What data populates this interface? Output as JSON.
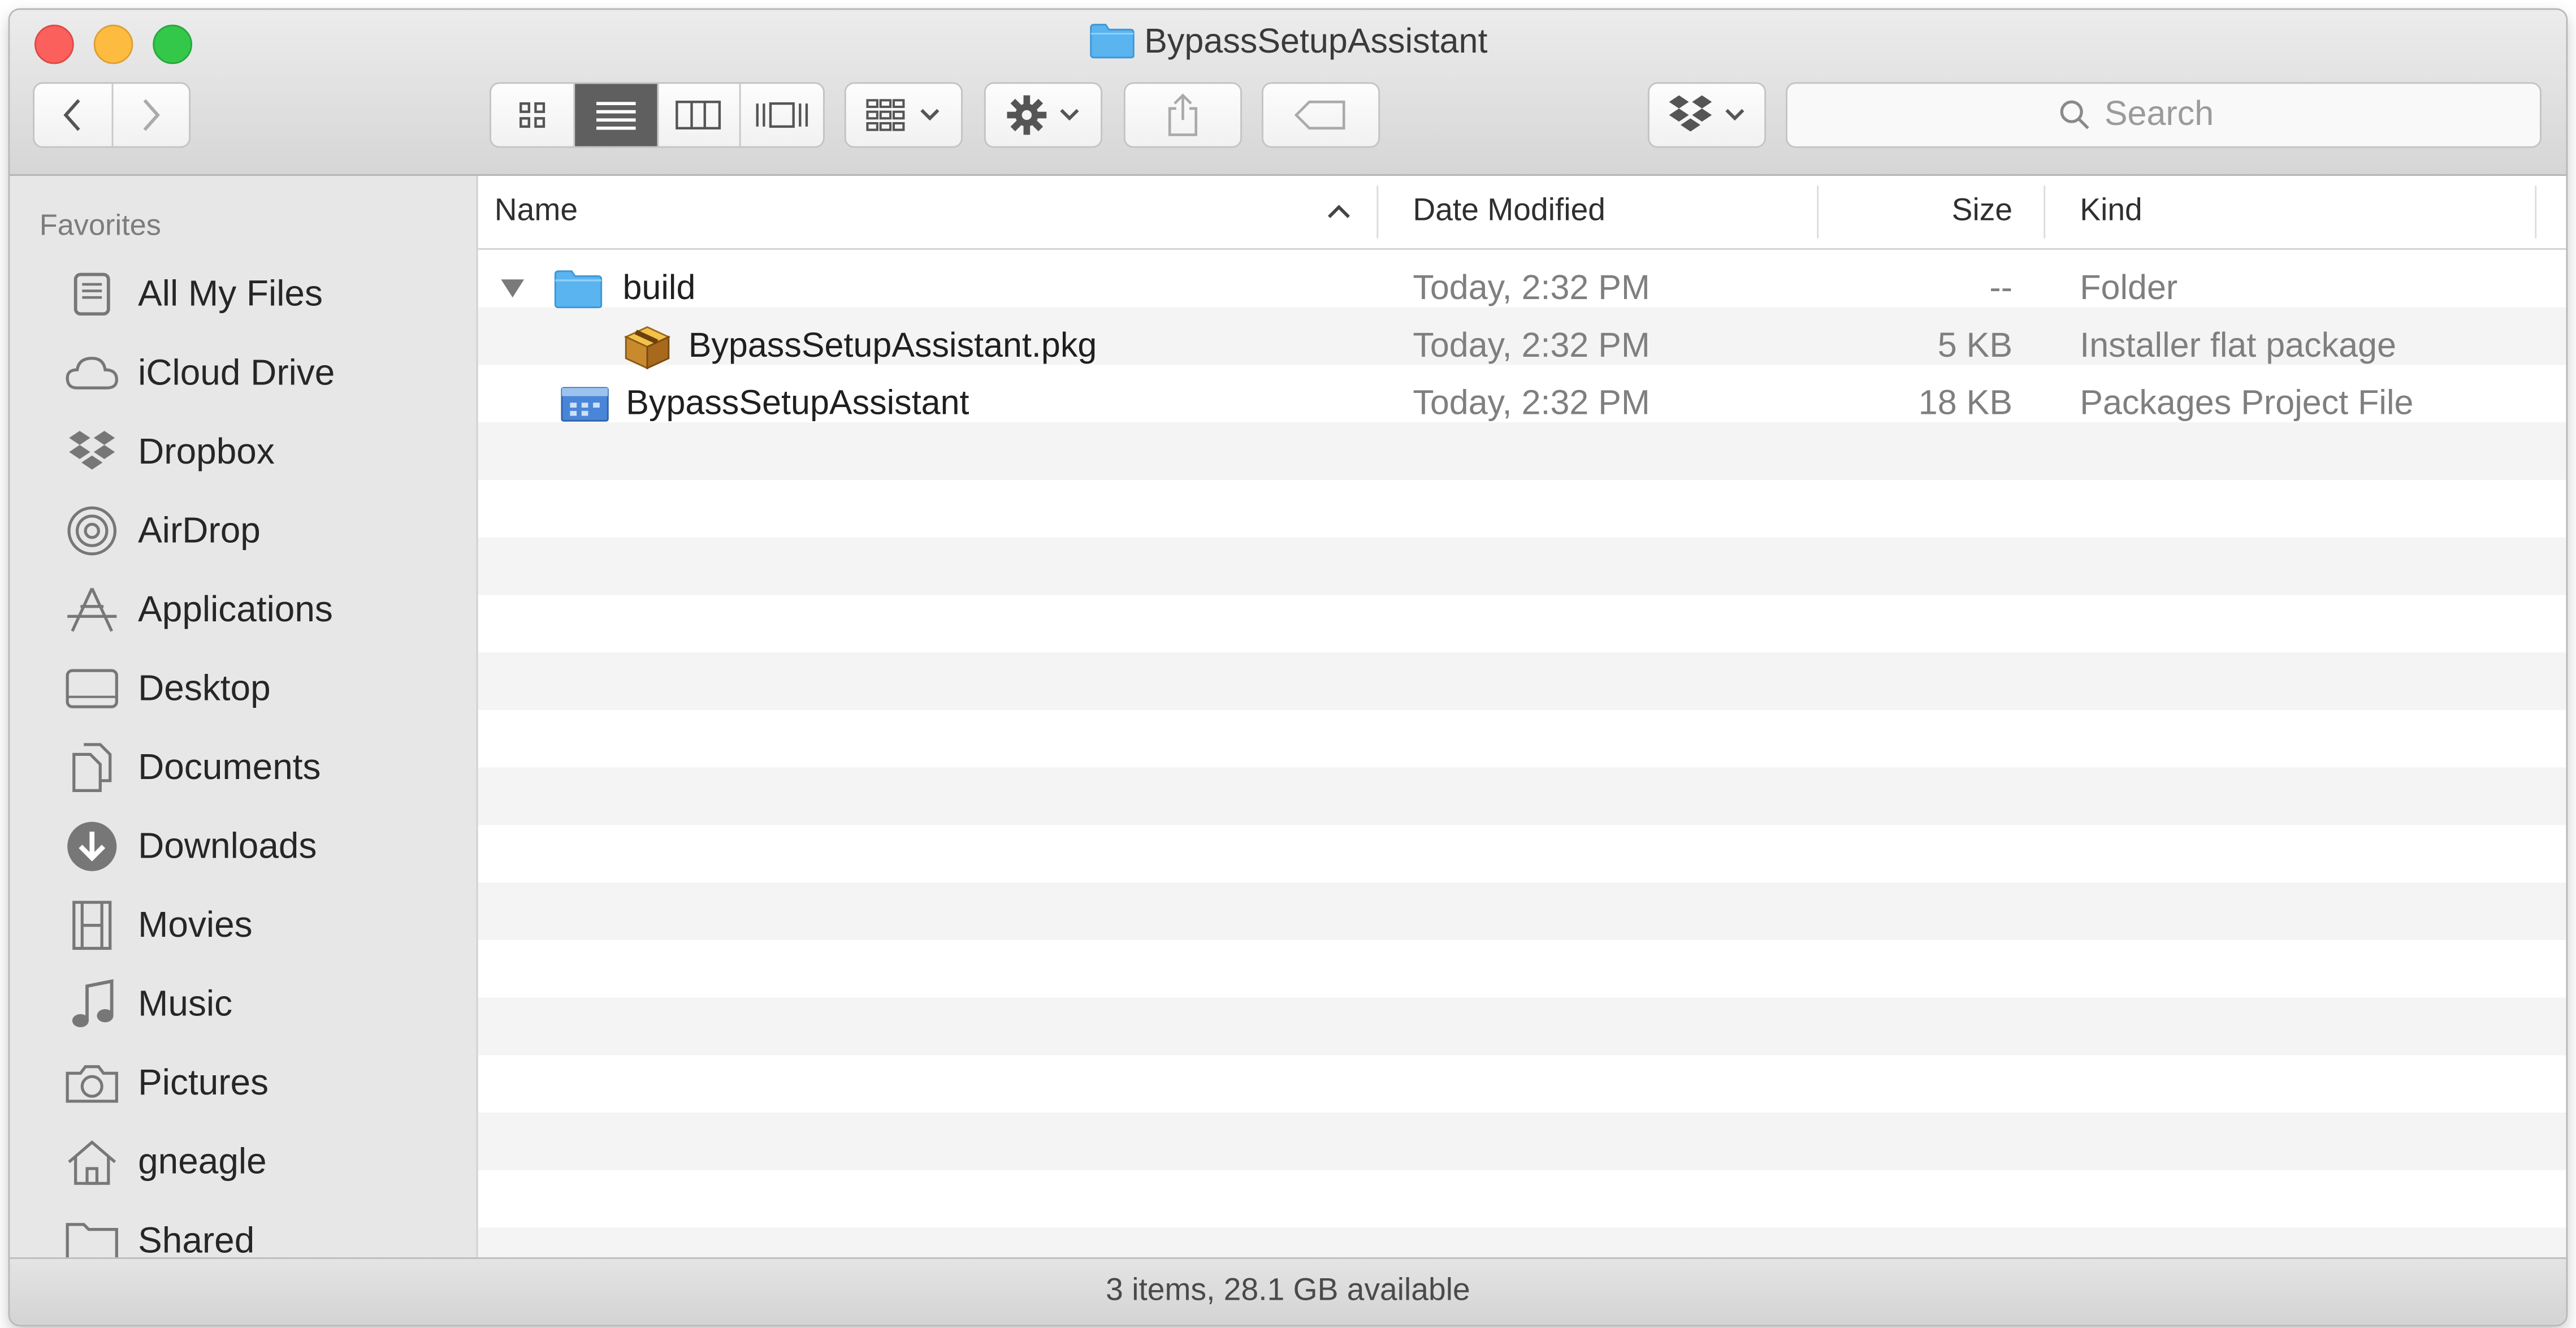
{
  "window": {
    "title": "BypassSetupAssistant",
    "status": "3 items, 28.1 GB available"
  },
  "toolbar": {
    "search_placeholder": "Search",
    "view_modes": [
      "icon-view",
      "list-view",
      "column-view",
      "cover-flow-view"
    ],
    "active_view": "list-view"
  },
  "sidebar": {
    "heading": "Favorites",
    "items": [
      {
        "label": "All My Files",
        "icon": "all-my-files-icon"
      },
      {
        "label": "iCloud Drive",
        "icon": "cloud-icon"
      },
      {
        "label": "Dropbox",
        "icon": "dropbox-icon"
      },
      {
        "label": "AirDrop",
        "icon": "airdrop-icon"
      },
      {
        "label": "Applications",
        "icon": "applications-icon"
      },
      {
        "label": "Desktop",
        "icon": "desktop-icon"
      },
      {
        "label": "Documents",
        "icon": "documents-icon"
      },
      {
        "label": "Downloads",
        "icon": "downloads-icon"
      },
      {
        "label": "Movies",
        "icon": "movies-icon"
      },
      {
        "label": "Music",
        "icon": "music-icon"
      },
      {
        "label": "Pictures",
        "icon": "camera-icon"
      },
      {
        "label": "gneagle",
        "icon": "home-icon"
      },
      {
        "label": "Shared",
        "icon": "shared-folder-icon"
      }
    ]
  },
  "list": {
    "columns": {
      "name": "Name",
      "date": "Date Modified",
      "size": "Size",
      "kind": "Kind"
    },
    "rows": [
      {
        "name": "build",
        "date": "Today, 2:32 PM",
        "size": "--",
        "kind": "Folder",
        "icon": "folder-icon",
        "expanded": true
      },
      {
        "name": "BypassSetupAssistant.pkg",
        "date": "Today, 2:32 PM",
        "size": "5 KB",
        "kind": "Installer flat package",
        "icon": "package-icon"
      },
      {
        "name": "BypassSetupAssistant",
        "date": "Today, 2:32 PM",
        "size": "18 KB",
        "kind": "Packages Project File",
        "icon": "packages-project-icon"
      }
    ]
  },
  "colors": {
    "close": "#fc605c",
    "minimize": "#fdbc40",
    "zoom": "#34c84a",
    "folder": "#5ab4f0",
    "active_segment": "#5f5f5f"
  }
}
